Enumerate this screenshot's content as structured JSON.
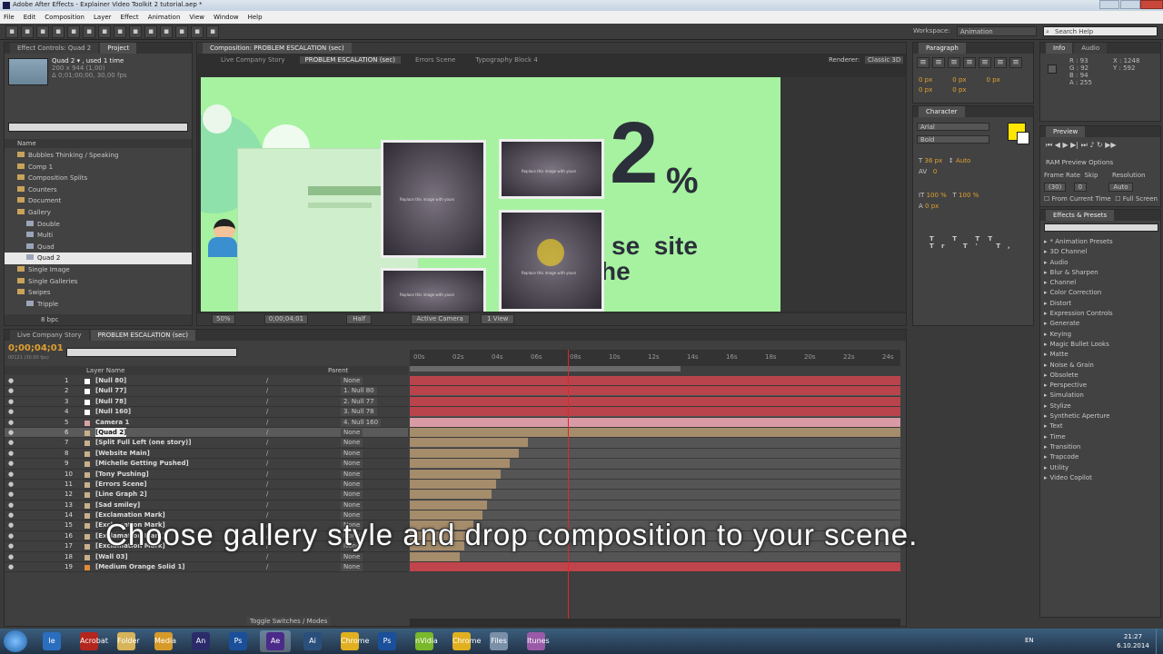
{
  "window": {
    "title": "Adobe After Effects - Explainer Video Toolkit 2 tutorial.aep *"
  },
  "menubar": [
    "File",
    "Edit",
    "Composition",
    "Layer",
    "Effect",
    "Animation",
    "View",
    "Window",
    "Help"
  ],
  "toolbar": {
    "workspace_label": "Workspace:",
    "workspace_value": "Animation",
    "search_placeholder": "Search Help"
  },
  "project": {
    "tabs": [
      "Effect Controls: Quad 2",
      "Project"
    ],
    "item_name": "Quad 2 ▾ , used 1 time",
    "item_size": "200 x 944 (1,00)",
    "item_dur": "Δ 0;01;00;00, 30,00 fps",
    "col_name": "Name",
    "tree": [
      {
        "label": "Bubbles Thinking / Speaking",
        "indent": 1
      },
      {
        "label": "Comp 1",
        "indent": 1
      },
      {
        "label": "Composition Splits",
        "indent": 1
      },
      {
        "label": "Counters",
        "indent": 1
      },
      {
        "label": "Document",
        "indent": 1
      },
      {
        "label": "Gallery",
        "indent": 1
      },
      {
        "label": "Double",
        "indent": 2
      },
      {
        "label": "Multi",
        "indent": 2
      },
      {
        "label": "Quad",
        "indent": 2
      },
      {
        "label": "Quad 2",
        "indent": 2,
        "selected": true
      },
      {
        "label": "Single Image",
        "indent": 1
      },
      {
        "label": "Single Galleries",
        "indent": 1
      },
      {
        "label": "Swipes",
        "indent": 1
      },
      {
        "label": "Tripple",
        "indent": 2
      }
    ],
    "bottom_label": "8 bpc"
  },
  "composition": {
    "tab": "Composition: PROBLEM ESCALATION (sec)",
    "breadcrumbs": [
      "Live Company Story",
      "PROBLEM ESCALATION (sec)",
      "Errors Scene",
      "Typography Block 4"
    ],
    "renderer_label": "Renderer:",
    "renderer_value": "Classic 3D",
    "view_label": "Active Camera",
    "zoom": "50%",
    "timecode": "0;00;04;01",
    "resolution": "Half",
    "views": "1 View",
    "canvas": {
      "big_number": "2",
      "percent": "%",
      "line1": "se  site",
      "line2": "he",
      "card_text": "Replace this image with yours",
      "accent_bg": "#a6f2a0"
    }
  },
  "paragraph": {
    "tabs": [
      "Paragraph"
    ],
    "values": [
      "0 px",
      "0 px",
      "0 px",
      "0 px",
      "0 px"
    ]
  },
  "character": {
    "tab": "Character",
    "font": "Arial",
    "style": "Bold",
    "size": "36 px",
    "leading": "Auto",
    "tracking": "0",
    "scale": "100 %",
    "baseline": "0 px",
    "swatch": "#ffe600"
  },
  "info": {
    "tabs": [
      "Info",
      "Audio"
    ],
    "r": "R : 93",
    "g": "G : 92",
    "b": "B : 94",
    "a": "A : 255",
    "x": "X : 1248",
    "y": "Y : 592"
  },
  "preview": {
    "tab": "Preview",
    "options": "RAM Preview Options",
    "framerate_label": "Frame Rate",
    "skip_label": "Skip",
    "resolution_label": "Resolution",
    "framerate": "(30)",
    "skip": "0",
    "resolution": "Auto",
    "from_current": "From Current Time",
    "full_screen": "Full Screen"
  },
  "effects": {
    "tab": "Effects & Presets",
    "items": [
      "* Animation Presets",
      "3D Channel",
      "Audio",
      "Blur & Sharpen",
      "Channel",
      "Color Correction",
      "Distort",
      "Expression Controls",
      "Generate",
      "Keying",
      "Magic Bullet Looks",
      "Matte",
      "Noise & Grain",
      "Obsolete",
      "Perspective",
      "Simulation",
      "Stylize",
      "Synthetic Aperture",
      "Text",
      "Time",
      "Transition",
      "Trapcode",
      "Utility",
      "Video Copilot"
    ]
  },
  "timeline": {
    "tabs": [
      "Live Company Story",
      "PROBLEM ESCALATION (sec)"
    ],
    "timecode": "0;00;04;01",
    "fps": "00121 (30.00 fps)",
    "col_layer": "Layer Name",
    "col_parent": "Parent",
    "toggle_label": "Toggle Switches / Modes",
    "ruler": [
      "00s",
      "02s",
      "04s",
      "06s",
      "08s",
      "10s",
      "12s",
      "14s",
      "16s",
      "18s",
      "20s",
      "22s",
      "24s"
    ],
    "layers": [
      {
        "n": "1",
        "name": "[Null 80]",
        "parent": "None",
        "color": "#ffffff",
        "bar": "#b9444b"
      },
      {
        "n": "2",
        "name": "[Null 77]",
        "parent": "1. Null 80",
        "color": "#ffffff",
        "bar": "#b9444b"
      },
      {
        "n": "3",
        "name": "[Null 78]",
        "parent": "2. Null 77",
        "color": "#ffffff",
        "bar": "#b9444b"
      },
      {
        "n": "4",
        "name": "[Null 160]",
        "parent": "3. Null 78",
        "color": "#ffffff",
        "bar": "#b9444b"
      },
      {
        "n": "5",
        "name": "Camera 1",
        "parent": "4. Null 160",
        "color": "#d9a0a8",
        "bar": "#d89aa4"
      },
      {
        "n": "6",
        "name": "[Quad 2]",
        "parent": "None",
        "color": "#c9b08a",
        "bar": "#a58c6b",
        "selected": true
      },
      {
        "n": "7",
        "name": "[Split Full Left (one story)]",
        "parent": "None",
        "color": "#c9b08a",
        "bar": "#a58c6b"
      },
      {
        "n": "8",
        "name": "[Website Main]",
        "parent": "None",
        "color": "#c9b08a",
        "bar": "#a58c6b"
      },
      {
        "n": "9",
        "name": "[Michelle Getting Pushed]",
        "parent": "None",
        "color": "#c9b08a",
        "bar": "#a58c6b"
      },
      {
        "n": "10",
        "name": "[Tony Pushing]",
        "parent": "None",
        "color": "#c9b08a",
        "bar": "#a58c6b"
      },
      {
        "n": "11",
        "name": "[Errors Scene]",
        "parent": "None",
        "color": "#c9b08a",
        "bar": "#a58c6b"
      },
      {
        "n": "12",
        "name": "[Line Graph 2]",
        "parent": "None",
        "color": "#c9b08a",
        "bar": "#a58c6b"
      },
      {
        "n": "13",
        "name": "[Sad smiley]",
        "parent": "None",
        "color": "#c9b08a",
        "bar": "#a58c6b"
      },
      {
        "n": "14",
        "name": "[Exclamation Mark]",
        "parent": "None",
        "color": "#c9b08a",
        "bar": "#a58c6b"
      },
      {
        "n": "15",
        "name": "[Exclamation Mark]",
        "parent": "None",
        "color": "#c9b08a",
        "bar": "#a58c6b"
      },
      {
        "n": "16",
        "name": "[Exclamation Mark]",
        "parent": "None",
        "color": "#c9b08a",
        "bar": "#a58c6b"
      },
      {
        "n": "17",
        "name": "[Exclamation Mark]",
        "parent": "None",
        "color": "#c9b08a",
        "bar": "#a58c6b"
      },
      {
        "n": "18",
        "name": "[Wall 03]",
        "parent": "None",
        "color": "#c9b08a",
        "bar": "#a58c6b"
      },
      {
        "n": "19",
        "name": "[Medium Orange Solid 1]",
        "parent": "None",
        "color": "#e08a3a",
        "bar": "#c0444b"
      }
    ]
  },
  "caption": "Choose gallery style and drop composition to your scene.",
  "taskbar": {
    "apps": [
      "Ie",
      "Acrobat",
      "Folder",
      "Media",
      "An",
      "Ps",
      "Ae",
      "Ai",
      "Chrome",
      "Ps",
      "nVidia",
      "Chrome",
      "Files",
      "Itunes"
    ],
    "lang": "EN",
    "time": "21:27",
    "date": "6.10.2014"
  }
}
